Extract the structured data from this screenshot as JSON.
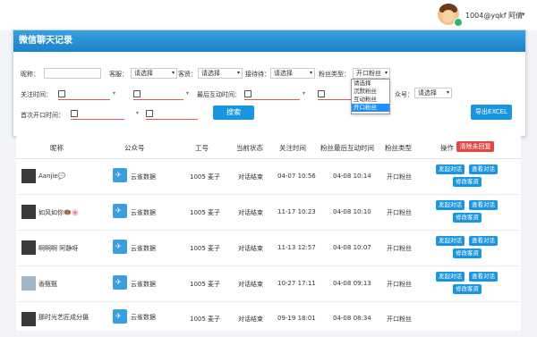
{
  "header": {
    "user": "1004@yqkf 阿倩",
    "caret": "▾"
  },
  "panel": {
    "title": "微信聊天记录",
    "filters": {
      "nickname_label": "昵称：",
      "kefu_label": "客服：",
      "kefu_value": "请选择",
      "kezi_label": "客资：",
      "kezi_value": "请选择",
      "reception_label": "接待待：",
      "reception_value": "请选择",
      "fan_type_label": "粉丝类型：",
      "fan_type_value": "开口粉丝",
      "follow_time_label": "关注时间：",
      "last_interact_label": "最后互动时间：",
      "account_label": "众号：",
      "account_value": "请选择",
      "first_open_label": "首次开口时间：",
      "search_button": "搜索",
      "export_button": "导出EXCEL",
      "fan_type_options": [
        "请选择",
        "沉默粉丝",
        "互动粉丝",
        "开口粉丝"
      ]
    }
  },
  "table": {
    "columns": [
      "昵称",
      "公众号",
      "工号",
      "当前状态",
      "关注时间",
      "粉丝最后互动时间",
      "粉丝类型",
      "操作"
    ],
    "clear_button": "清除未回复",
    "action_labels": {
      "start": "发起对话",
      "view": "查看对话",
      "edit": "修改客资"
    },
    "rows": [
      {
        "nickname": "Aanjie💬",
        "account": "云雀数据",
        "id": "1005 麦子",
        "status": "对话结束",
        "follow": "04-07 10:56",
        "last": "04-08 10:14",
        "type": "开口粉丝"
      },
      {
        "nickname": "如风如你🍩🌸",
        "account": "云雀数据",
        "id": "1005 麦子",
        "status": "对话结束",
        "follow": "11-17 10:23",
        "last": "04-08 10:10",
        "type": "开口粉丝"
      },
      {
        "nickname": "啊啊啊 阿静呀",
        "account": "云雀数据",
        "id": "1005 麦子",
        "status": "对话结束",
        "follow": "11-13 12:57",
        "last": "04-08 10:07",
        "type": "开口粉丝"
      },
      {
        "nickname": "香甄甄",
        "account": "云雀数据",
        "id": "1005 麦子",
        "status": "对话结束",
        "follow": "10-27 17:11",
        "last": "04-08 09:13",
        "type": "开口粉丝"
      },
      {
        "nickname": "那时光艺匠成分摄",
        "account": "云雀数据",
        "id": "1005 麦子",
        "status": "对话结束",
        "follow": "09-19 18:01",
        "last": "04-08 08:34",
        "type": "开口粉丝"
      }
    ]
  }
}
